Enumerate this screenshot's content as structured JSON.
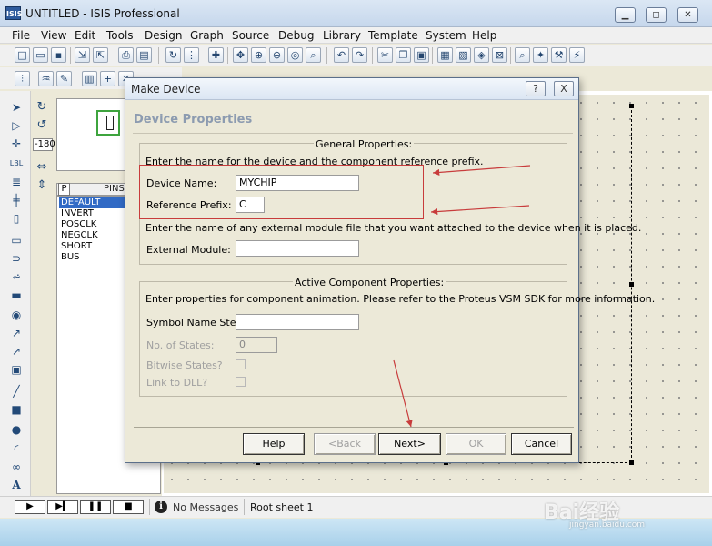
{
  "window": {
    "logo": "ISIS",
    "title": "UNTITLED - ISIS Professional"
  },
  "menu": [
    "File",
    "View",
    "Edit",
    "Tools",
    "Design",
    "Graph",
    "Source",
    "Debug",
    "Library",
    "Template",
    "System",
    "Help"
  ],
  "rotation_value": "-180",
  "device_list": {
    "tab_p": "P",
    "header": "PINS",
    "items": [
      "DEFAULT",
      "INVERT",
      "POSCLK",
      "NEGCLK",
      "SHORT",
      "BUS"
    ],
    "selected": "DEFAULT"
  },
  "status": {
    "message": "No Messages",
    "sheet": "Root sheet 1"
  },
  "dialog": {
    "title": "Make Device",
    "help_btn": "?",
    "close_btn": "X",
    "header": "Device Properties",
    "general": {
      "title": "General Properties:",
      "intro": "Enter the name for the device and the component reference prefix.",
      "device_name_label": "Device Name:",
      "device_name_value": "MYCHIP",
      "reference_prefix_label": "Reference Prefix:",
      "reference_prefix_value": "C",
      "module_text": "Enter the name of any external module file that you want attached to the device when it is placed.",
      "external_module_label": "External Module:",
      "external_module_value": ""
    },
    "active": {
      "title": "Active Component Properties:",
      "intro": "Enter properties for component animation. Please refer to the Proteus VSM SDK for more information.",
      "symbol_name_stem_label": "Symbol Name Stem:",
      "symbol_name_stem_value": "",
      "num_states_label": "No. of States:",
      "num_states_value": "0",
      "bitwise_label": "Bitwise States?",
      "link_dll_label": "Link to DLL?"
    },
    "buttons": {
      "help": "Help",
      "back": "<Back",
      "next": "Next>",
      "ok": "OK",
      "cancel": "Cancel"
    }
  },
  "watermark": {
    "text": "Bai经验",
    "sub": "jingyan.baidu.com"
  },
  "colors": {
    "selection": "#316ac5",
    "annotation_red": "#c83c3c",
    "header_text": "#8c9bb0"
  }
}
